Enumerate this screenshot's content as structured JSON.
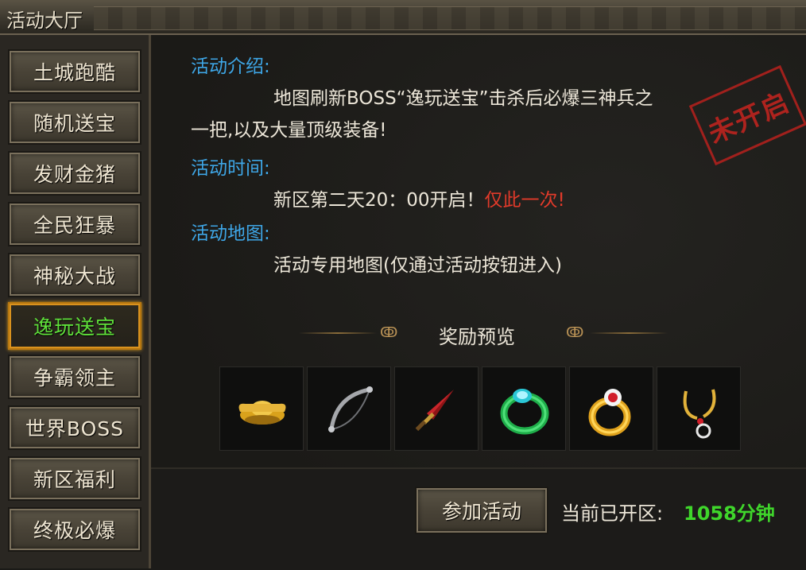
{
  "window": {
    "title": "活动大厅"
  },
  "sidebar": {
    "items": [
      {
        "label": "土城跑酷",
        "active": false
      },
      {
        "label": "随机送宝",
        "active": false
      },
      {
        "label": "发财金猪",
        "active": false
      },
      {
        "label": "全民狂暴",
        "active": false
      },
      {
        "label": "神秘大战",
        "active": false
      },
      {
        "label": "逸玩送宝",
        "active": true
      },
      {
        "label": "争霸领主",
        "active": false
      },
      {
        "label": "世界BOSS",
        "active": false
      },
      {
        "label": "新区福利",
        "active": false
      },
      {
        "label": "终极必爆",
        "active": false
      }
    ]
  },
  "activity": {
    "intro_heading": "活动介绍:",
    "intro_line1": "地图刷新BOSS“逸玩送宝”击杀后必爆三神兵之",
    "intro_line2": "一把,以及大量顶级装备!",
    "time_heading": "活动时间:",
    "time_text": "新区第二天20：00开启！",
    "time_highlight": "仅此一次!",
    "map_heading": "活动地图:",
    "map_text": "活动专用地图(仅通过活动按钮进入)",
    "stamp": "未开启"
  },
  "rewards": {
    "title": "奖励预览",
    "items": [
      {
        "icon": "gold-ingot-icon"
      },
      {
        "icon": "bow-icon"
      },
      {
        "icon": "sword-icon"
      },
      {
        "icon": "jade-ring-icon"
      },
      {
        "icon": "gold-ruby-ring-icon"
      },
      {
        "icon": "necklace-icon"
      }
    ]
  },
  "footer": {
    "join_label": "参加活动",
    "open_label": "当前已开区:",
    "open_value": "1058分钟"
  },
  "colors": {
    "heading": "#3ea6e6",
    "highlight": "#e23a2a",
    "active_text": "#5fe03a",
    "value_green": "#3fd62b"
  }
}
